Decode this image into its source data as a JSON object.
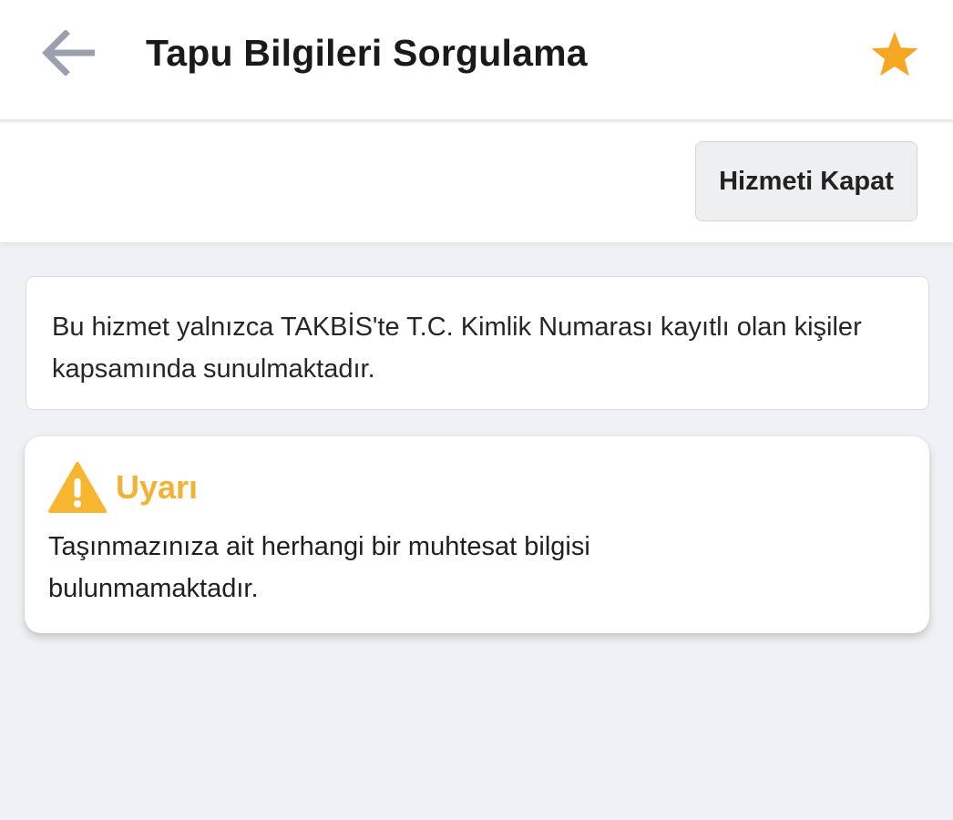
{
  "header": {
    "title": "Tapu Bilgileri Sorgulama",
    "back_icon": "arrow-left-icon",
    "favorite_icon": "star-icon",
    "favorite_color": "#f5a623"
  },
  "actions": {
    "close_service_label": "Hizmeti Kapat"
  },
  "info": {
    "text": "Bu hizmet yalnızca TAKBİS'te T.C. Kimlik Numarası kayıtlı olan kişiler kapsamında sunulmaktadır."
  },
  "warning": {
    "icon": "warning-triangle-icon",
    "title": "Uyarı",
    "title_color": "#f2b233",
    "message": "Taşınmazınıza ait herhangi bir muhtesat bilgisi bulunmamaktadır."
  },
  "colors": {
    "background": "#eff1f4",
    "surface": "#ffffff",
    "warning_accent": "#f7b62f"
  }
}
